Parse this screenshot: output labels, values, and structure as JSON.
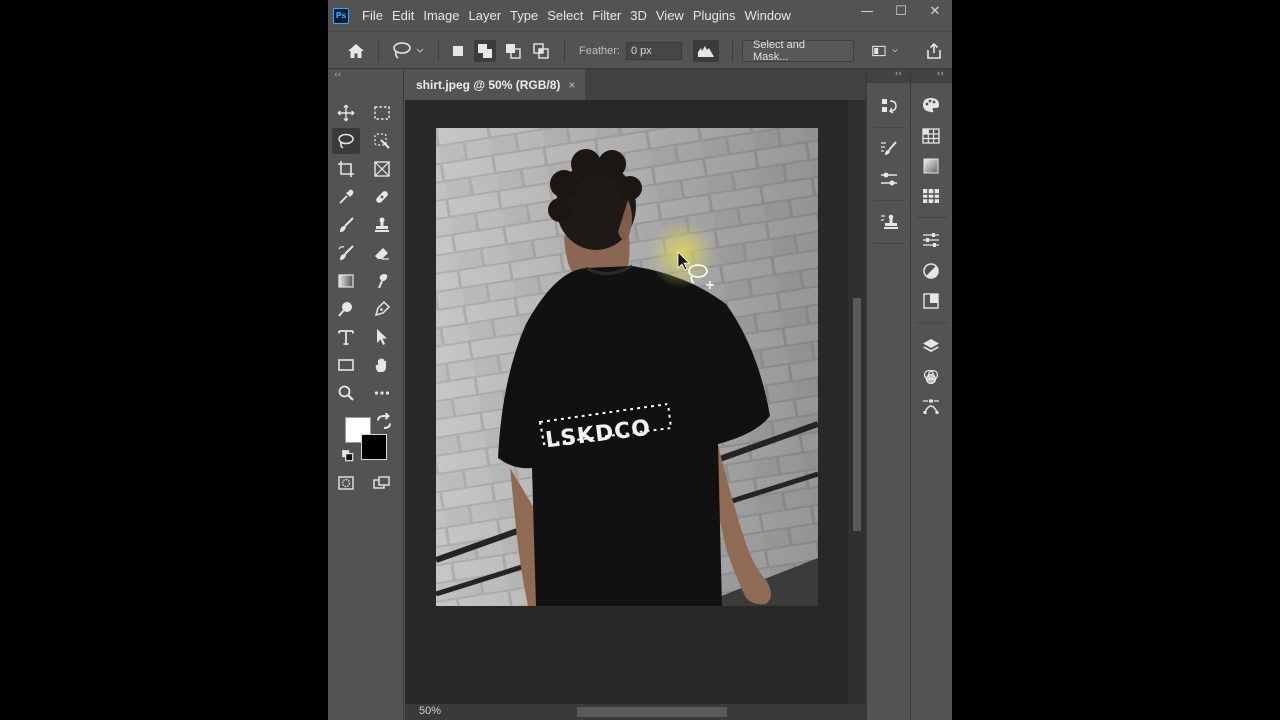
{
  "app": {
    "logo_text": "Ps",
    "menu": [
      "File",
      "Edit",
      "Image",
      "Layer",
      "Type",
      "Select",
      "Filter",
      "3D",
      "View",
      "Plugins",
      "Window"
    ],
    "window_controls": {
      "minimize": "—",
      "restore": "☐",
      "close": "✕"
    }
  },
  "options": {
    "feather_label": "Feather:",
    "feather_value": "0 px",
    "select_and_mask": "Select and Mask..."
  },
  "document": {
    "tab_title": "shirt.jpeg @ 50% (RGB/8)",
    "tab_close": "×",
    "zoom": "50%"
  },
  "photo": {
    "shirt_print": "LSKDCO"
  },
  "colors": {
    "foreground": "#ffffff",
    "background": "#000000",
    "ui_bg": "#535353",
    "canvas_bg": "#282828"
  },
  "tools": {
    "active": "lasso-tool",
    "items": [
      "move",
      "marquee",
      "lasso",
      "object-selection",
      "crop",
      "frame",
      "eyedropper",
      "healing-brush",
      "brush",
      "clone-stamp",
      "history-brush",
      "eraser",
      "gradient",
      "smudge",
      "dodge",
      "pen",
      "type",
      "path-selection",
      "rectangle",
      "hand",
      "zoom",
      "more",
      "quick-mask",
      "screen-mode"
    ]
  },
  "panels": {
    "collapse_glyph": "‹‹"
  }
}
